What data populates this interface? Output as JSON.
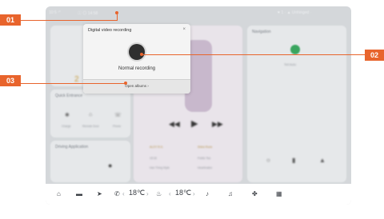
{
  "dialog": {
    "title": "Digital video recording",
    "close_glyph": "×",
    "record_label": "Normal recording",
    "open_albums_label": "Open albums",
    "open_albums_chevron": "›"
  },
  "callouts": {
    "c1": "01",
    "c2": "02",
    "c3": "03"
  },
  "statusbar": {
    "time": "10:5 ⁷°",
    "mid": "ⓘ ◎ 14:58",
    "right": "♥ 1 · ▲ Unhinged ·"
  },
  "background": {
    "navigation_title": "Navigation",
    "nav_sub": "Tell Auto",
    "quick_title": "Quick Entrance",
    "quick_items": [
      "Charge",
      "Remote Door",
      "Phone"
    ],
    "driving_title": "Driving Application",
    "music_meta": [
      "ALOY R.S.",
      "Shine Rune",
      "15:18",
      "Public Tea",
      "Han Thing Style",
      "Heartmates"
    ],
    "big_digit": "2"
  },
  "dock": {
    "temp_left": "18℃",
    "temp_right": "18℃",
    "arrow_left": "‹",
    "arrow_right": "›"
  },
  "colors": {
    "accent": "#e8642c",
    "screen": "#d4d7da",
    "dialog": "#f4f4f4"
  },
  "icons": [
    "home-icon",
    "car-icon",
    "navigate-icon",
    "phone-icon",
    "seat-icon",
    "music-icon",
    "fan-icon",
    "apps-icon"
  ]
}
